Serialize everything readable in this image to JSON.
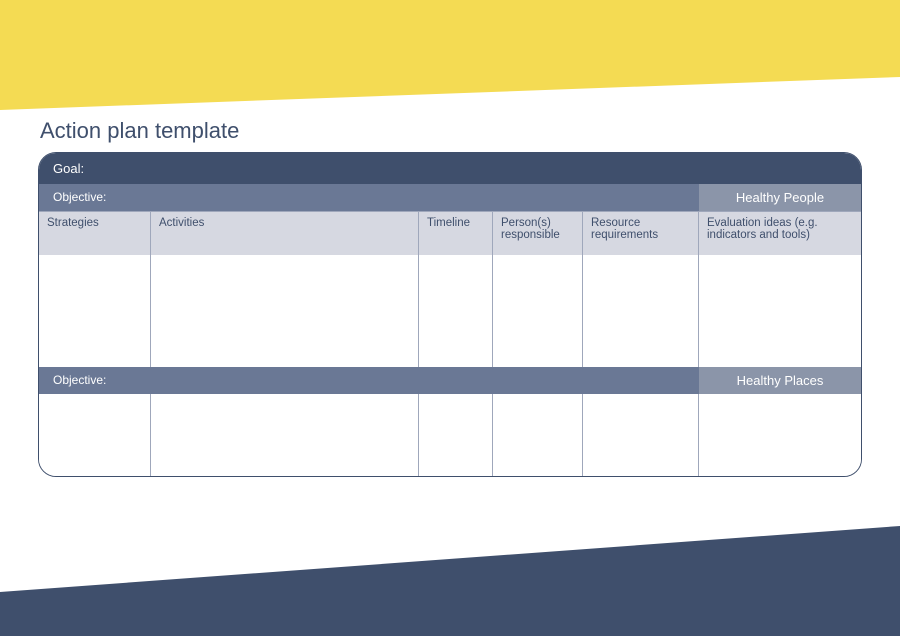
{
  "title": "Action plan template",
  "goal_label": "Goal:",
  "columns": {
    "strategies": "Strategies",
    "activities": "Activities",
    "timeline": "Timeline",
    "persons": "Person(s) responsible",
    "resource": "Resource requirements",
    "evaluation": "Evaluation ideas (e.g. indicators and tools)"
  },
  "sections": [
    {
      "objective_label": "Objective:",
      "tag": "Healthy People"
    },
    {
      "objective_label": "Objective:",
      "tag": "Healthy Places"
    }
  ]
}
